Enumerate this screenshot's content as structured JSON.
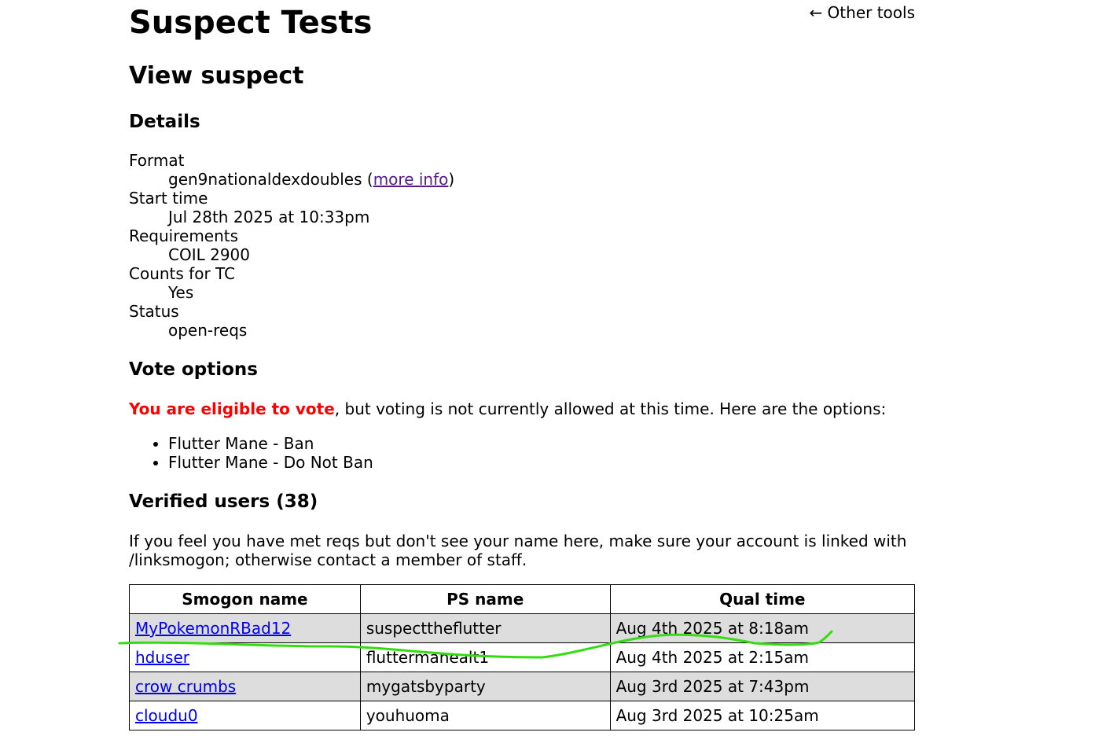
{
  "header": {
    "title": "Suspect Tests",
    "other_tools": "← Other tools"
  },
  "view_title": "View suspect",
  "details": {
    "heading": "Details",
    "format_label": "Format",
    "format_value": "gen9nationaldexdoubles",
    "format_paren_open": " (",
    "more_info": "more info",
    "format_paren_close": ")",
    "start_label": "Start time",
    "start_value": "Jul 28th 2025 at 10:33pm",
    "requirements_label": "Requirements",
    "requirements_value": "COIL 2900",
    "counts_label": "Counts for TC",
    "counts_value": "Yes",
    "status_label": "Status",
    "status_value": "open-reqs"
  },
  "vote": {
    "heading": "Vote options",
    "eligible": "You are eligible to vote",
    "message": ", but voting is not currently allowed at this time. Here are the options:",
    "options": [
      "Flutter Mane - Ban",
      "Flutter Mane - Do Not Ban"
    ]
  },
  "verified": {
    "heading": "Verified users (38)",
    "note": "If you feel you have met reqs but don't see your name here, make sure your account is linked with /linksmogon; otherwise contact a member of staff.",
    "columns": [
      "Smogon name",
      "PS name",
      "Qual time"
    ],
    "rows": [
      {
        "smogon": "MyPokemonRBad12",
        "ps": "suspecttheflutter",
        "time": "Aug 4th 2025 at 8:18am"
      },
      {
        "smogon": "hduser",
        "ps": "fluttermanealt1",
        "time": "Aug 4th 2025 at 2:15am"
      },
      {
        "smogon": "crow crumbs",
        "ps": "mygatsbyparty",
        "time": "Aug 3rd 2025 at 7:43pm"
      },
      {
        "smogon": "cloudu0",
        "ps": "youhuoma",
        "time": "Aug 3rd 2025 at 10:25am"
      }
    ]
  },
  "colors": {
    "eligible": "#ff0000",
    "link": "#0000ee",
    "visited_link": "#551a8b",
    "row_shade": "#dddddd",
    "annotation": "#33dd11"
  }
}
